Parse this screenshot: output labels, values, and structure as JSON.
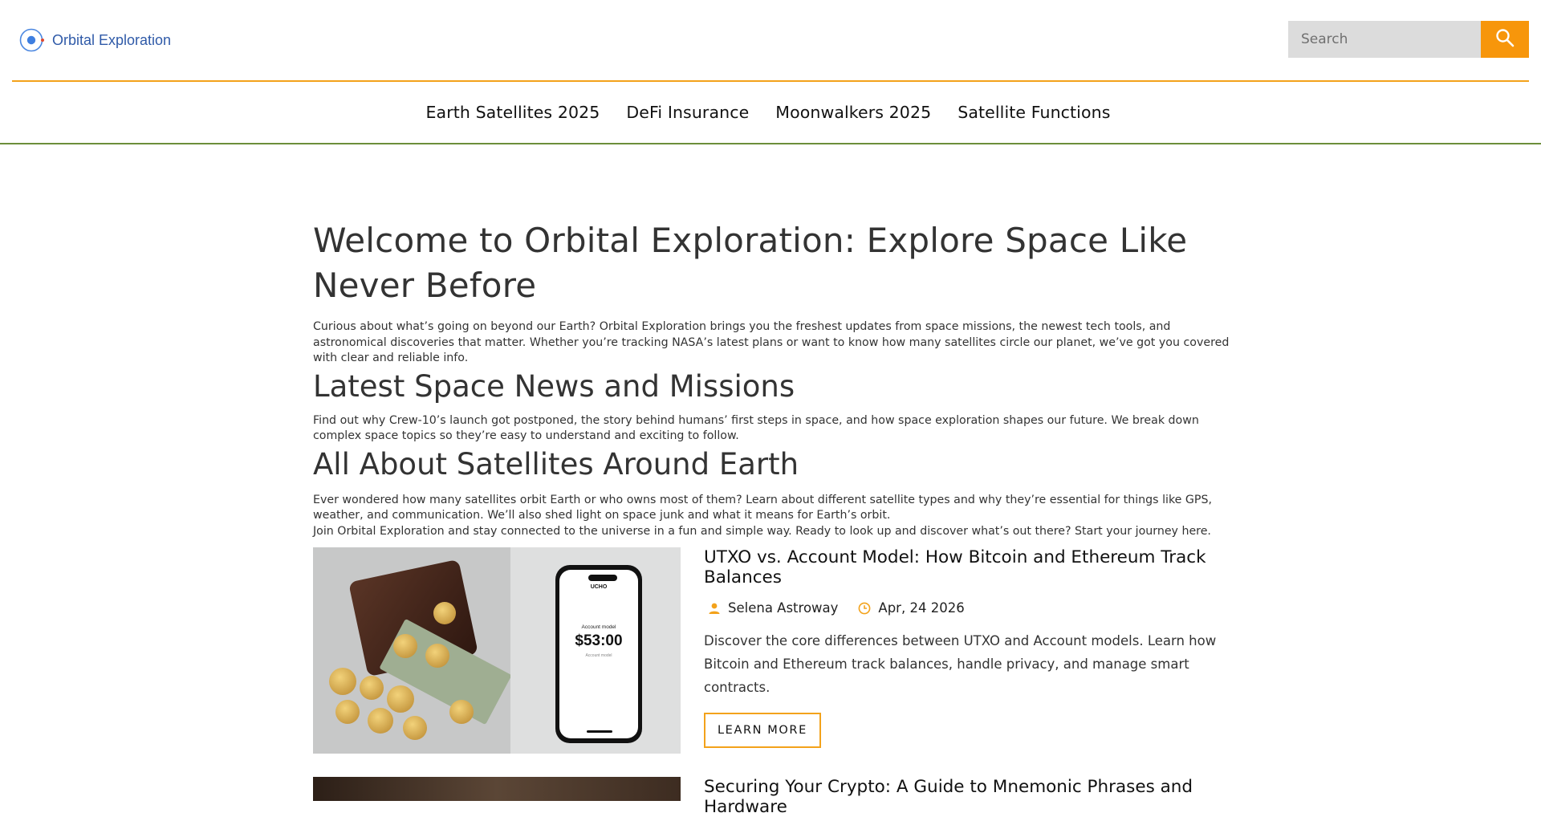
{
  "header": {
    "logo_text": "Orbital Exploration",
    "search_placeholder": "Search",
    "accent_color": "#f7960b",
    "brand_color": "#2f5aa8"
  },
  "nav": {
    "items": [
      "Earth Satellites 2025",
      "DeFi Insurance",
      "Moonwalkers 2025",
      "Satellite Functions"
    ]
  },
  "main": {
    "title": "Welcome to Orbital Exploration: Explore Space Like Never Before",
    "intro": "Curious about what’s going on beyond our Earth? Orbital Exploration brings you the freshest updates from space missions, the newest tech tools, and astronomical discoveries that matter. Whether you’re tracking NASA’s latest plans or want to know how many satellites circle our planet, we’ve got you covered with clear and reliable info.",
    "section1_title": "Latest Space News and Missions",
    "section1_text": "Find out why Crew-10’s launch got postponed, the story behind humans’ first steps in space, and how space exploration shapes our future. We break down complex space topics so they’re easy to understand and exciting to follow.",
    "section2_title": "All About Satellites Around Earth",
    "section2_text1": "Ever wondered how many satellites orbit Earth or who owns most of them? Learn about different satellite types and why they’re essential for things like GPS, weather, and communication. We’ll also shed light on space junk and what it means for Earth’s orbit.",
    "section2_text2": "Join Orbital Exploration and stay connected to the universe in a fun and simple way. Ready to look up and discover what’s out there? Start your journey here."
  },
  "posts": [
    {
      "title": "UTXO vs. Account Model: How Bitcoin and Ethereum Track Balances",
      "author": "Selena Astroway",
      "date": "Apr, 24 2026",
      "excerpt": "Discover the core differences between UTXO and Account models. Learn how Bitcoin and Ethereum track balances, handle privacy, and manage smart contracts.",
      "button": "LEARN MORE",
      "image": {
        "phone_app": "UCHO",
        "phone_label": "Account model",
        "phone_amount": "$53:00",
        "phone_sub": "Account model"
      }
    },
    {
      "title": "Securing Your Crypto: A Guide to Mnemonic Phrases and Hardware"
    }
  ]
}
